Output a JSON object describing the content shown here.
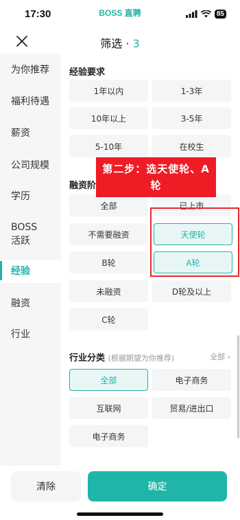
{
  "status_bar": {
    "time": "17:30",
    "app_name": "BOSS 直聘",
    "battery": "85"
  },
  "header": {
    "title": "筛选 · ",
    "count": "3"
  },
  "sidebar": {
    "items": [
      {
        "label": "为你推荐",
        "active": false
      },
      {
        "label": "福利待遇",
        "active": false
      },
      {
        "label": "薪资",
        "active": false
      },
      {
        "label": "公司规模",
        "active": false
      },
      {
        "label": "学历",
        "active": false
      },
      {
        "label": "BOSS活跃",
        "active": false
      },
      {
        "label": "经验",
        "active": true
      },
      {
        "label": "融资",
        "active": false
      },
      {
        "label": "行业",
        "active": false
      }
    ]
  },
  "experience": {
    "title": "经验要求",
    "options": [
      "1年以内",
      "1-3年",
      "10年以上",
      "3-5年",
      "5-10年",
      "在校生"
    ]
  },
  "financing": {
    "title": "融资阶段",
    "options": [
      "全部",
      "已上市",
      "不需要融资",
      "天使轮",
      "B轮",
      "A轮",
      "未融资",
      "D轮及以上",
      "C轮"
    ],
    "selected": [
      "天使轮",
      "A轮"
    ]
  },
  "industry": {
    "title": "行业分类",
    "hint": "(根据期望为你推荐)",
    "more": "全部 ›",
    "options": [
      "全部",
      "电子商务",
      "互联网",
      "贸易/进出口",
      "电子商务"
    ],
    "selected": [
      "全部"
    ]
  },
  "annotation": {
    "line1": "第二步：选天使轮、A",
    "line2": "轮"
  },
  "footer": {
    "clear_label": "清除",
    "confirm_label": "确定"
  },
  "colors": {
    "accent": "#20b3a8",
    "annotation_red": "#ee1c25"
  },
  "icons": {
    "close": "close-icon",
    "signal": "signal-icon",
    "wifi": "wifi-icon",
    "battery": "battery-icon"
  }
}
